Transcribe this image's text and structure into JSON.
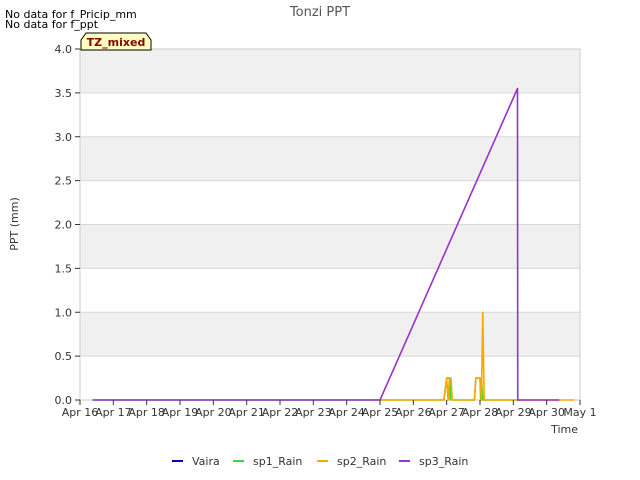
{
  "notices": [
    "No data for f_Pricip_mm",
    "No data for f_ppt"
  ],
  "badge": "TZ_mixed",
  "colors": {
    "band": "#f0f0f0",
    "grid": "#d8d8d8",
    "axis": "#333333",
    "badge_bg": "#ffffc0",
    "badge_text": "#8b0000"
  },
  "chart_data": {
    "type": "line",
    "title": "Tonzi PPT",
    "xlabel": "Time",
    "ylabel": "PPT (mm)",
    "x_ticks": [
      "Apr 16",
      "Apr 17",
      "Apr 18",
      "Apr 19",
      "Apr 20",
      "Apr 21",
      "Apr 22",
      "Apr 23",
      "Apr 24",
      "Apr 25",
      "Apr 26",
      "Apr 27",
      "Apr 28",
      "Apr 29",
      "Apr 30",
      "May 1"
    ],
    "y_ticks": [
      "0.0",
      "0.5",
      "1.0",
      "1.5",
      "2.0",
      "2.5",
      "3.0",
      "3.5",
      "4.0"
    ],
    "xlim": [
      "Apr 16 00:00",
      "May 1 00:00"
    ],
    "ylim": [
      0,
      4
    ],
    "grid": true,
    "legend_position": "bottom",
    "series": [
      {
        "name": "Vaira",
        "color": "#0000bb",
        "points": []
      },
      {
        "name": "sp1_Rain",
        "color": "#33dd33",
        "points": [
          [
            "Apr 16 09:00",
            0
          ],
          [
            "Apr 26 22:00",
            0
          ],
          [
            "Apr 27 00:00",
            0.25
          ],
          [
            "Apr 27 02:00",
            0.25
          ],
          [
            "Apr 27 02:30",
            0
          ],
          [
            "Apr 27 03:00",
            0.25
          ],
          [
            "Apr 27 04:00",
            0
          ],
          [
            "Apr 27 20:00",
            0
          ],
          [
            "Apr 27 21:00",
            0.25
          ],
          [
            "Apr 28 00:00",
            0.25
          ],
          [
            "Apr 28 00:30",
            0
          ],
          [
            "Apr 28 01:00",
            0.25
          ],
          [
            "Apr 28 02:00",
            0
          ],
          [
            "Apr 29 06:00",
            0
          ]
        ]
      },
      {
        "name": "sp2_Rain",
        "color": "#ffa500",
        "points": [
          [
            "Apr 25 00:00",
            0
          ],
          [
            "Apr 26 22:00",
            0
          ],
          [
            "Apr 27 00:00",
            0.25
          ],
          [
            "Apr 27 01:00",
            0
          ],
          [
            "Apr 27 02:00",
            0.25
          ],
          [
            "Apr 27 03:00",
            0.25
          ],
          [
            "Apr 27 04:00",
            0
          ],
          [
            "Apr 27 20:00",
            0
          ],
          [
            "Apr 27 21:00",
            0.25
          ],
          [
            "Apr 28 00:00",
            0.25
          ],
          [
            "Apr 28 01:00",
            0
          ],
          [
            "Apr 28 02:00",
            1.0
          ],
          [
            "Apr 28 03:00",
            0
          ],
          [
            "Apr 30 20:00",
            0
          ]
        ]
      },
      {
        "name": "sp3_Rain",
        "color": "#9932cc",
        "points": [
          [
            "Apr 16 09:00",
            0
          ],
          [
            "Apr 25 00:00",
            0
          ],
          [
            "Apr 29 03:00",
            3.55
          ],
          [
            "Apr 29 03:10",
            0
          ],
          [
            "Apr 30 09:00",
            0
          ]
        ]
      }
    ]
  }
}
